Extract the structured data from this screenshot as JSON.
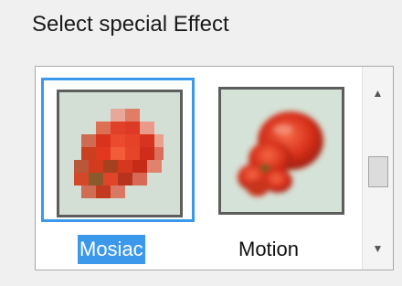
{
  "dialog": {
    "title": "Select special Effect"
  },
  "effects": {
    "items": [
      {
        "label": "Mosiac",
        "selected": true,
        "icon": "mosaic-tomato-thumbnail"
      },
      {
        "label": "Motion",
        "selected": false,
        "icon": "motion-tomato-thumbnail"
      }
    ]
  },
  "scrollbar": {
    "up_icon": "chevron-up-icon",
    "down_icon": "chevron-down-icon"
  },
  "colors": {
    "selection": "#3c98ea",
    "thumb_background": "#d6e3d9",
    "tomato_red": "#d82f1c"
  }
}
